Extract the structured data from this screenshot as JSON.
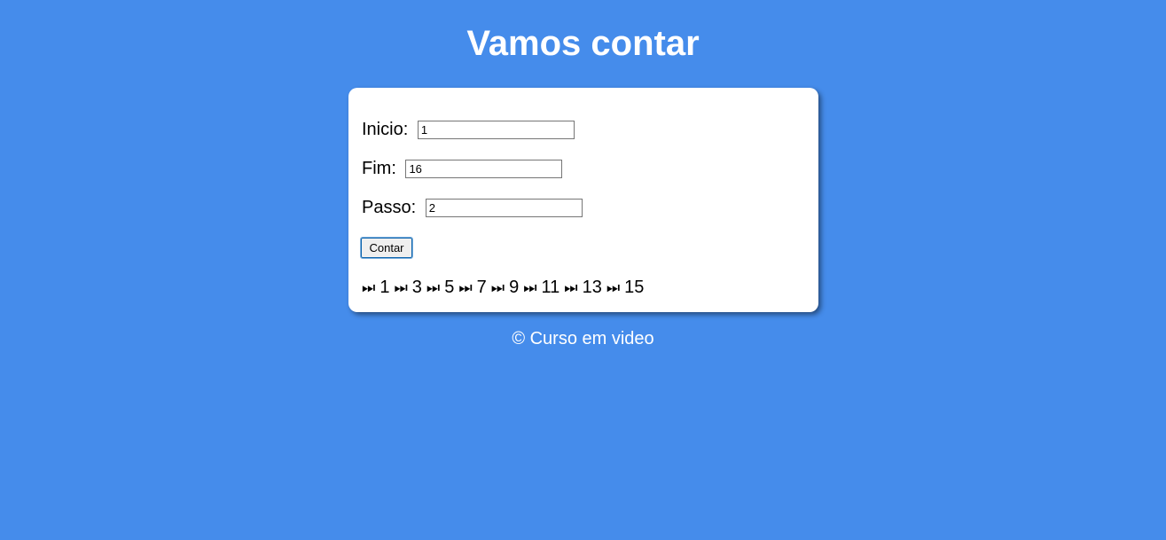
{
  "header": {
    "title": "Vamos contar"
  },
  "form": {
    "inicio": {
      "label": "Inicio: ",
      "value": "1"
    },
    "fim": {
      "label": "Fim: ",
      "value": "16"
    },
    "passo": {
      "label": "Passo: ",
      "value": "2"
    },
    "button_label": "Contar"
  },
  "result": {
    "step_icon": "next-track-icon",
    "step_glyph": "⏭",
    "values": [
      "1",
      "3",
      "5",
      "7",
      "9",
      "11",
      "13",
      "15"
    ]
  },
  "footer": {
    "text": "© Curso em video"
  },
  "colors": {
    "background": "#458CEB",
    "card": "#ffffff",
    "text_light": "#ffffff"
  }
}
